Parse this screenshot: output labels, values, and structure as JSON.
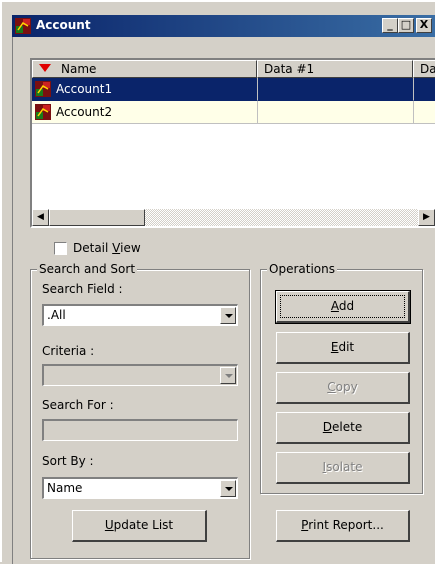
{
  "window": {
    "title": "Account",
    "min_glyph": "_",
    "max_glyph": "□",
    "close_glyph": "X"
  },
  "list": {
    "columns": [
      {
        "label": "Name",
        "sort": "descending"
      },
      {
        "label": "Data #1"
      },
      {
        "label": "Da"
      }
    ],
    "rows": [
      {
        "name": "Account1",
        "selected": true
      },
      {
        "name": "Account2",
        "selected": false
      }
    ],
    "scroll_left": "◀",
    "scroll_right": "▶"
  },
  "detail_view": {
    "label_pre": "Detail ",
    "label_accel": "V",
    "label_post": "iew",
    "checked": false
  },
  "search_sort": {
    "group_label": "Search and Sort",
    "search_field_label": "Search Field :",
    "search_field_value": ".All",
    "criteria_label": "Criteria :",
    "criteria_value": "",
    "search_for_label": "Search For :",
    "search_for_value": "",
    "sort_by_label": "Sort By :",
    "sort_by_value": "Name",
    "update": {
      "pre": "",
      "accel": "U",
      "post": "pdate List"
    }
  },
  "operations": {
    "group_label": "Operations",
    "add": {
      "pre": "",
      "accel": "A",
      "post": "dd"
    },
    "edit": {
      "pre": "",
      "accel": "E",
      "post": "dit"
    },
    "copy": {
      "pre": "",
      "accel": "C",
      "post": "opy"
    },
    "delete": {
      "pre": "",
      "accel": "D",
      "post": "elete"
    },
    "isolate": {
      "pre": "",
      "accel": "I",
      "post": "solate"
    },
    "print": {
      "pre": "",
      "accel": "P",
      "post": "rint Report..."
    }
  },
  "colors": {
    "title_start": "#0a246a",
    "title_end": "#3a6ea5",
    "selected_row": "#0a246a",
    "alt_row": "#ffffe8",
    "face": "#d4d0c8"
  },
  "icons": {
    "app": "account-icon",
    "row": "account-icon",
    "sort_arrow": "sort-desc-arrow-icon"
  }
}
